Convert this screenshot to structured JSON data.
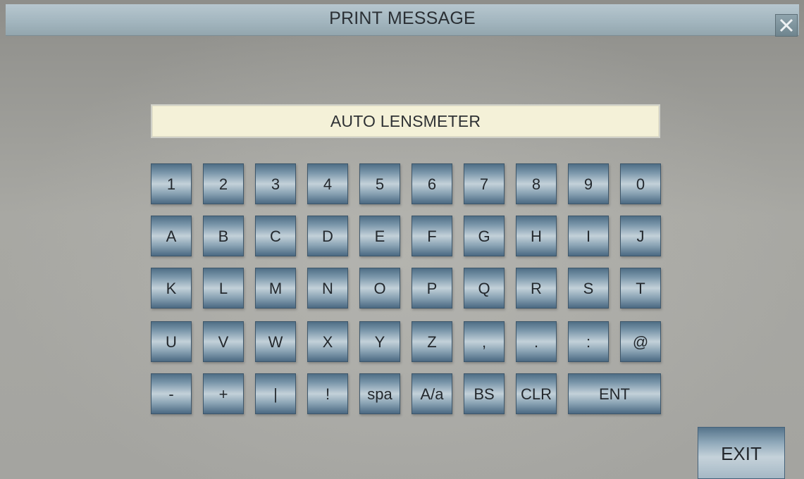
{
  "window": {
    "title": "PRINT MESSAGE",
    "close_icon": "close-icon"
  },
  "message": {
    "value": "AUTO LENSMETER"
  },
  "keyboard": {
    "rows": [
      [
        "1",
        "2",
        "3",
        "4",
        "5",
        "6",
        "7",
        "8",
        "9",
        "0"
      ],
      [
        "A",
        "B",
        "C",
        "D",
        "E",
        "F",
        "G",
        "H",
        "I",
        "J"
      ],
      [
        "K",
        "L",
        "M",
        "N",
        "O",
        "P",
        "Q",
        "R",
        "S",
        "T"
      ],
      [
        "U",
        "V",
        "W",
        "X",
        "Y",
        "Z",
        ",",
        ".",
        ":",
        "@"
      ],
      [
        "-",
        "+",
        "|",
        "!",
        "spa",
        "A/a",
        "BS",
        "CLR",
        "ENT"
      ]
    ]
  },
  "footer": {
    "exit_label": "EXIT"
  },
  "colors": {
    "title_bar": "#a3b6bf",
    "message_field": "#f4f1d8",
    "key_dark": "#4f6e86",
    "key_light": "#c3d1d9",
    "background": "#a8a8a3"
  }
}
